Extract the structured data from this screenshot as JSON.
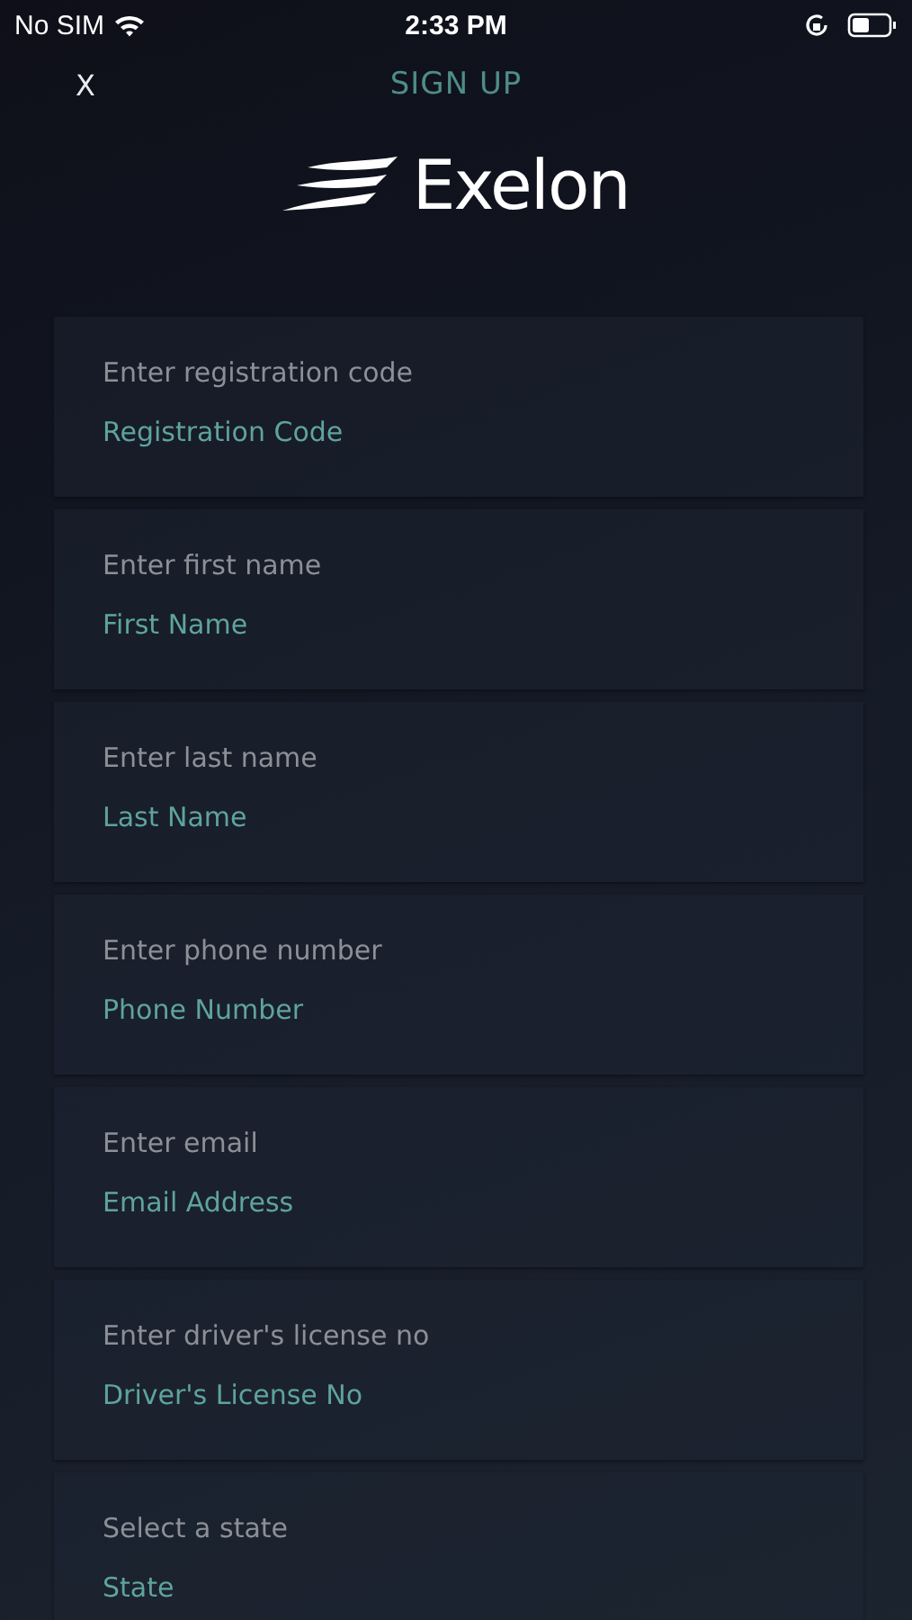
{
  "status_bar": {
    "carrier": "No SIM",
    "time": "2:33 PM"
  },
  "header": {
    "close": "X",
    "title": "SIGN UP"
  },
  "logo": {
    "name": "Exelon"
  },
  "fields": [
    {
      "label": "Enter registration code",
      "placeholder": "Registration Code"
    },
    {
      "label": "Enter first name",
      "placeholder": "First Name"
    },
    {
      "label": "Enter last name",
      "placeholder": "Last Name"
    },
    {
      "label": "Enter phone number",
      "placeholder": "Phone Number"
    },
    {
      "label": "Enter email",
      "placeholder": "Email Address"
    },
    {
      "label": "Enter driver's license no",
      "placeholder": "Driver's License No"
    },
    {
      "label": "Select a state",
      "placeholder": "State"
    }
  ]
}
